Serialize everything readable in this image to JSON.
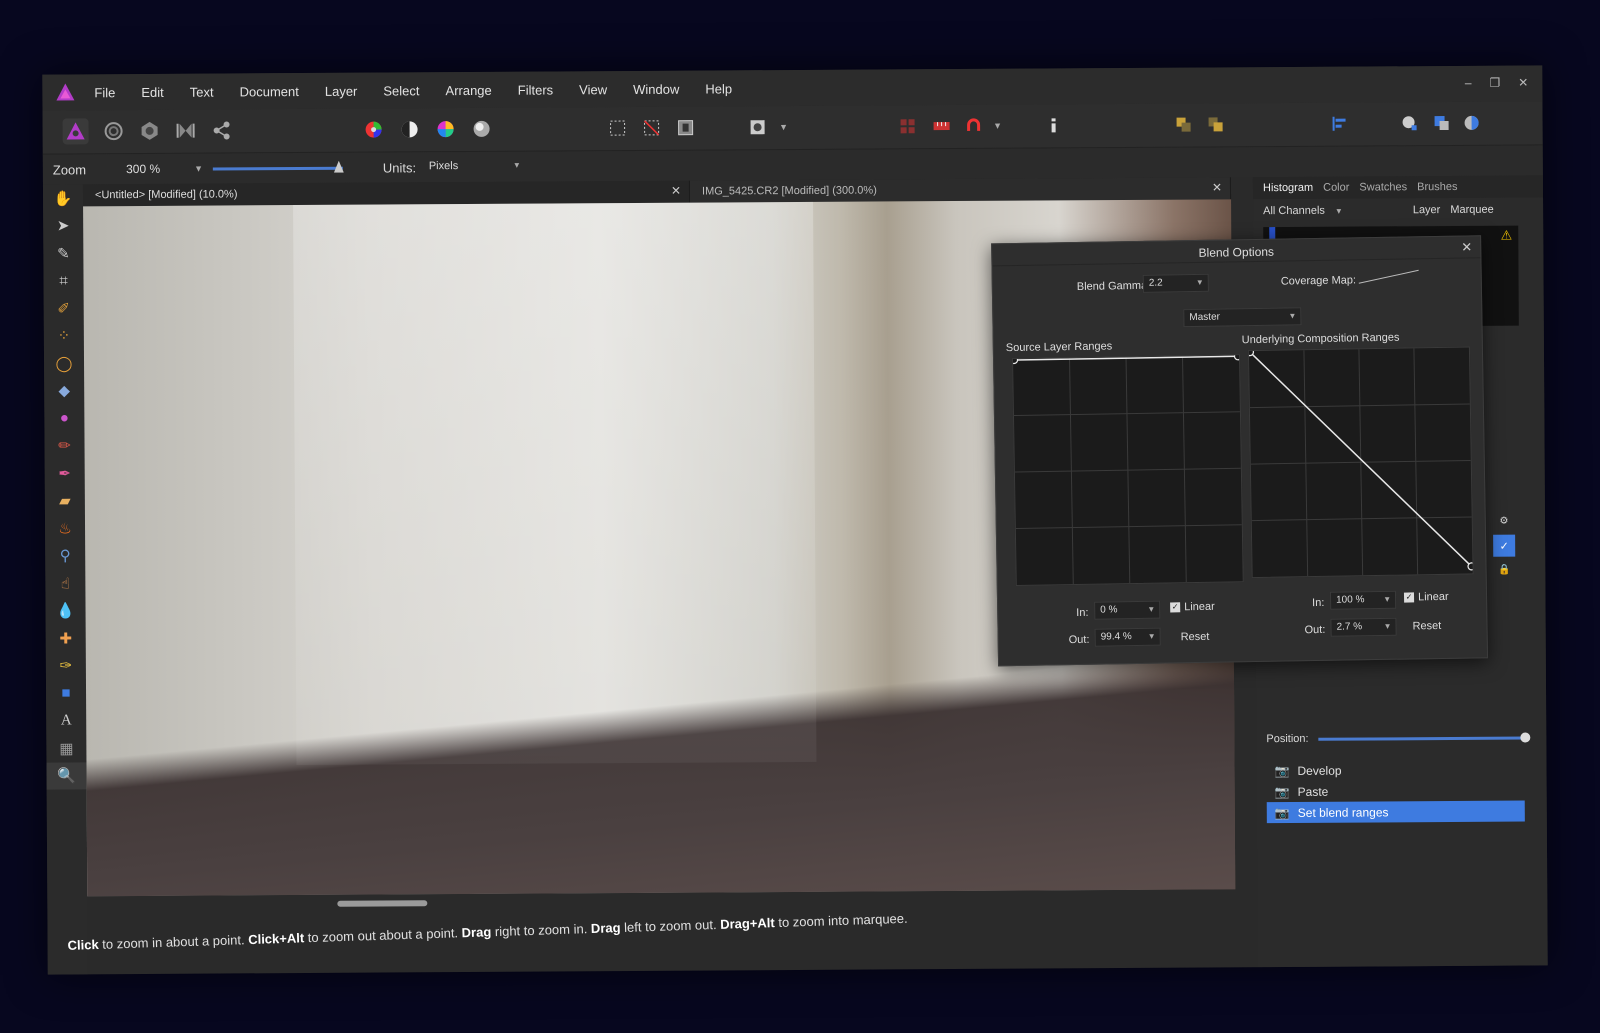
{
  "menu": [
    "File",
    "Edit",
    "Text",
    "Document",
    "Layer",
    "Select",
    "Arrange",
    "Filters",
    "View",
    "Window",
    "Help"
  ],
  "window_controls": {
    "minimize": "–",
    "restore": "❐",
    "close": "✕"
  },
  "toolbar_icons": [
    "persona-photo-icon",
    "persona-liquify-icon",
    "persona-develop-icon",
    "persona-tone-map-icon",
    "persona-export-icon",
    "color-wheel-icon",
    "half-circle-icon",
    "hue-wheel-icon",
    "sphere-icon",
    "marquee-rect-icon",
    "marquee-clear-icon",
    "marquee-invert-icon",
    "quickmask-icon",
    "grid-icon",
    "ruler-icon",
    "magnet-icon",
    "info-icon",
    "arrange-back-icon",
    "arrange-front-icon",
    "align-icon",
    "brush-icon",
    "lasso-icon",
    "circle-icon"
  ],
  "context": {
    "zoom_label": "Zoom",
    "zoom_value": "300 %",
    "units_label": "Units:",
    "units_value": "Pixels"
  },
  "tabs": [
    {
      "title": "<Untitled> [Modified] (10.0%)",
      "active": true
    },
    {
      "title": "IMG_5425.CR2 [Modified] (300.0%)",
      "active": false
    }
  ],
  "tools": [
    "hand-icon",
    "pointer-icon",
    "eyedropper-icon",
    "crop-icon",
    "selection-brush-icon",
    "flood-select-icon",
    "freehand-select-icon",
    "fill-icon",
    "gradient-icon",
    "paint-brush-icon",
    "color-replace-icon",
    "eraser-icon",
    "dodge-icon",
    "clone-icon",
    "smudge-icon",
    "blur-icon",
    "healing-icon",
    "pen-icon",
    "shape-icon",
    "text-icon",
    "mesh-icon",
    "zoom-icon"
  ],
  "statusbar": {
    "part1_b": "Click",
    "part1": " to zoom in about a point. ",
    "part2_b": "Click+Alt",
    "part2": " to zoom out about a point. ",
    "part3_b": "Drag",
    "part3": " right to zoom in. ",
    "part4_b": "Drag",
    "part4": " left to zoom out. ",
    "part5_b": "Drag+Alt",
    "part5": " to zoom into marquee."
  },
  "right_panel": {
    "tabs": [
      "Histogram",
      "Color",
      "Swatches",
      "Brushes"
    ],
    "channel": "All Channels",
    "layer_label": "Layer",
    "marquee_label": "Marquee",
    "position_label": "Position:",
    "history": [
      {
        "label": "Develop",
        "selected": false
      },
      {
        "label": "Paste",
        "selected": false
      },
      {
        "label": "Set blend ranges",
        "selected": true
      }
    ]
  },
  "dialog": {
    "title": "Blend Options",
    "blend_gamma_label": "Blend Gamma:",
    "blend_gamma_value": "2.2",
    "coverage_map_label": "Coverage Map:",
    "channel_value": "Master",
    "source": {
      "title": "Source Layer Ranges",
      "in_label": "In:",
      "in_value": "0 %",
      "out_label": "Out:",
      "out_value": "99.4 %",
      "linear_label": "Linear",
      "reset_label": "Reset",
      "curve": [
        [
          0,
          1.0
        ],
        [
          1,
          1.0
        ]
      ]
    },
    "underlying": {
      "title": "Underlying Composition Ranges",
      "in_label": "In:",
      "in_value": "100 %",
      "out_label": "Out:",
      "out_value": "2.7 %",
      "linear_label": "Linear",
      "reset_label": "Reset",
      "curve": [
        [
          0,
          1.0
        ],
        [
          1,
          0.027
        ]
      ]
    }
  },
  "colors": {
    "accent": "#3e7be0",
    "app_logo": "#b23cc8"
  }
}
